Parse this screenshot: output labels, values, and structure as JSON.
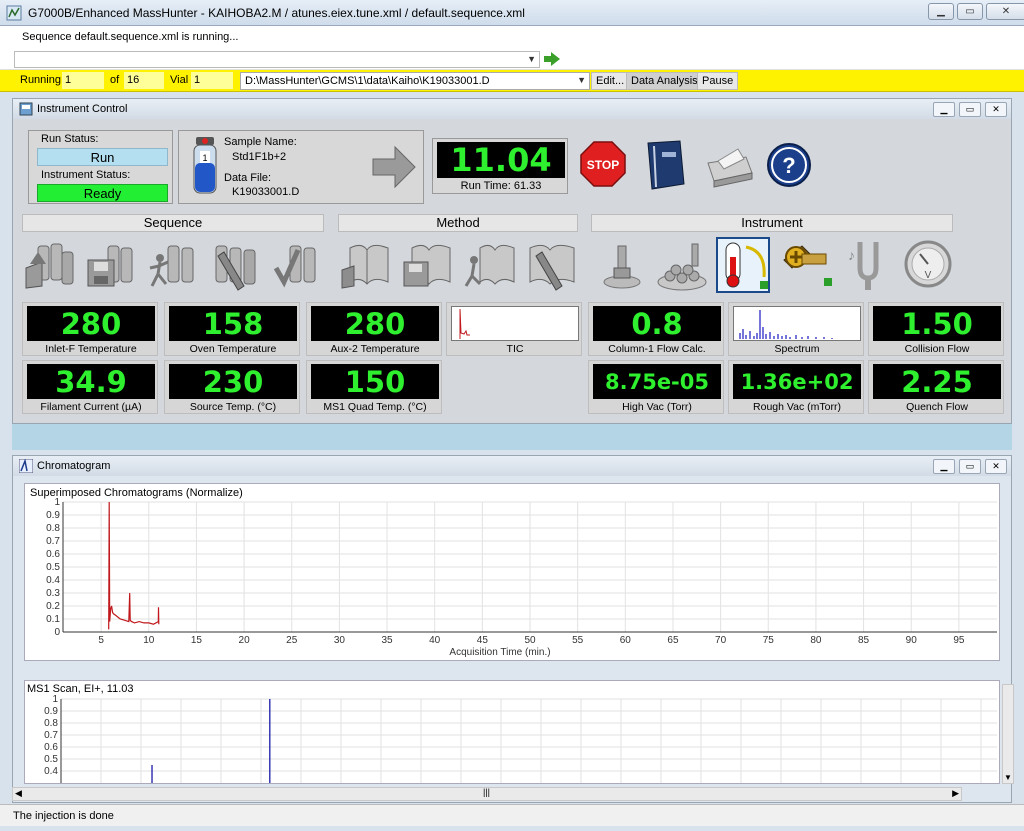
{
  "window": {
    "title": "G7000B/Enhanced MassHunter - KAIHOBA2.M / atunes.eiex.tune.xml / default.sequence.xml"
  },
  "run_message": "Sequence default.sequence.xml is running...",
  "toolbar": {
    "running_label": "Running",
    "running_value": "1",
    "of_label": "of",
    "of_value": "16",
    "vial_label": "Vial",
    "vial_value": "1",
    "data_path": "D:\\MassHunter\\GCMS\\1\\data\\Kaiho\\K19033001.D",
    "edit_label": "Edit...",
    "data_analysis_label": "Data Analysis",
    "pause_label": "Pause"
  },
  "instrument_control": {
    "title": "Instrument Control",
    "run_status_label": "Run Status:",
    "run_status": "Run",
    "instrument_status_label": "Instrument Status:",
    "instrument_status": "Ready",
    "sample_name_label": "Sample Name:",
    "sample_name": "Std1F1b+2",
    "data_file_label": "Data File:",
    "data_file": "K19033001.D",
    "run_time_value": "11.04",
    "run_time_label": "Run Time: 61.33",
    "stop_label": "STOP",
    "groups": {
      "sequence": "Sequence",
      "method": "Method",
      "instrument": "Instrument"
    },
    "tiles": [
      {
        "value": "280",
        "caption": "Inlet-F Temperature"
      },
      {
        "value": "158",
        "caption": "Oven Temperature"
      },
      {
        "value": "280",
        "caption": "Aux-2 Temperature"
      },
      {
        "caption": "TIC"
      },
      {
        "value": "0.8",
        "caption": "Column-1 Flow Calc."
      },
      {
        "caption": "Spectrum"
      },
      {
        "value": "1.50",
        "caption": "Collision Flow"
      },
      {
        "value": "34.9",
        "caption": "Filament Current (µA)"
      },
      {
        "value": "230",
        "caption": "Source Temp. (°C)"
      },
      {
        "value": "150",
        "caption": "MS1 Quad Temp. (°C)"
      },
      {
        "value": "8.75e-05",
        "caption": "High Vac (Torr)"
      },
      {
        "value": "1.36e+02",
        "caption": "Rough Vac (mTorr)"
      },
      {
        "value": "2.25",
        "caption": "Quench Flow"
      }
    ]
  },
  "chromatogram": {
    "title": "Chromatogram",
    "chart_title": "Superimposed Chromatograms (Normalize)",
    "xlabel": "Acquisition Time (min.)"
  },
  "ms_scan": {
    "title": "MS1 Scan, EI+, 11.03"
  },
  "status_bar": "The injection is done",
  "chart_data": [
    {
      "type": "line",
      "title": "Superimposed Chromatograms (Normalize)",
      "xlabel": "Acquisition Time (min.)",
      "ylabel": "",
      "xlim": [
        1,
        99
      ],
      "ylim": [
        0,
        1
      ],
      "x_ticks": [
        5,
        10,
        15,
        20,
        25,
        30,
        35,
        40,
        45,
        50,
        55,
        60,
        65,
        70,
        75,
        80,
        85,
        90,
        95
      ],
      "y_ticks": [
        0,
        0.1,
        0.2,
        0.3,
        0.4,
        0.5,
        0.6,
        0.7,
        0.8,
        0.9,
        1
      ],
      "grid": true,
      "series": [
        {
          "x": [
            5.8,
            5.85,
            5.9,
            6.0,
            6.1,
            6.2,
            6.3,
            6.5,
            7.0,
            7.5,
            7.9,
            8.0,
            8.05,
            8.2,
            8.5,
            9.0,
            9.5,
            10.0,
            10.5,
            11.0,
            11.02,
            11.05
          ],
          "y": [
            0.02,
            1.0,
            0.08,
            0.18,
            0.2,
            0.15,
            0.14,
            0.13,
            0.1,
            0.09,
            0.08,
            0.3,
            0.09,
            0.08,
            0.07,
            0.08,
            0.07,
            0.07,
            0.06,
            0.08,
            0.19,
            0.06
          ],
          "color": "#c0181c"
        }
      ]
    },
    {
      "type": "bar",
      "title": "MS1 Scan, EI+, 11.03",
      "ylim": [
        0,
        1
      ],
      "y_ticks": [
        0.4,
        0.5,
        0.6,
        0.7,
        0.8,
        0.9,
        1
      ],
      "grid": true,
      "series": [
        {
          "x": [
            0.17,
            0.39
          ],
          "y": [
            0.45,
            1.0
          ],
          "color": "#1a1aa8"
        }
      ]
    }
  ]
}
